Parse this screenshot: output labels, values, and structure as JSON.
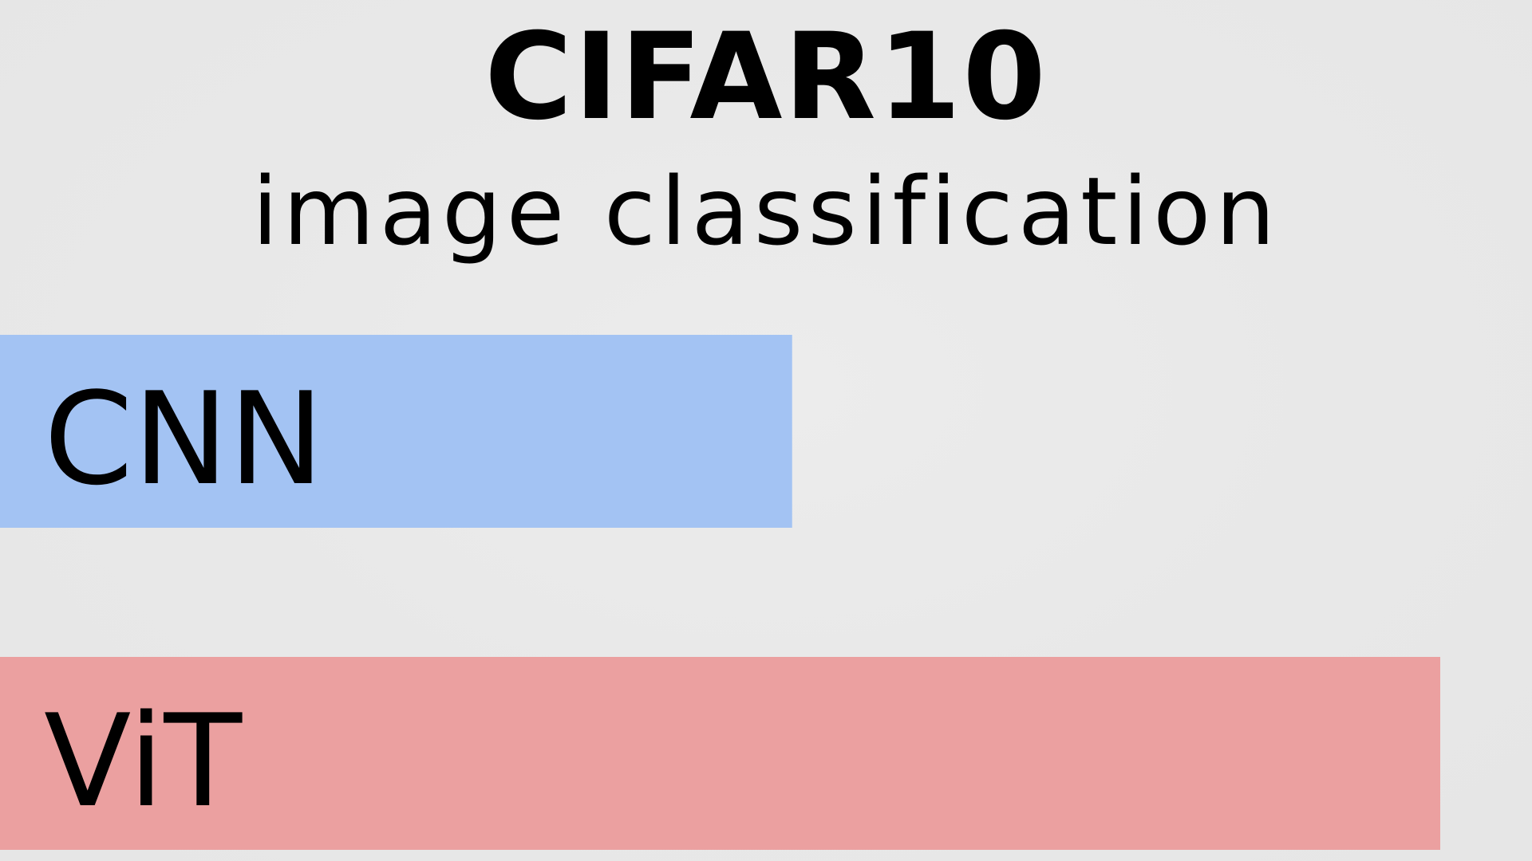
{
  "chart_data": {
    "type": "bar",
    "orientation": "horizontal",
    "title": "CIFAR10",
    "subtitle": "image classification",
    "categories": [
      "CNN",
      "ViT"
    ],
    "values": [
      0.55,
      1.0
    ],
    "colors": [
      "#a3c3f3",
      "#eba0a0"
    ],
    "xlabel": "",
    "ylabel": "",
    "grid": false
  }
}
